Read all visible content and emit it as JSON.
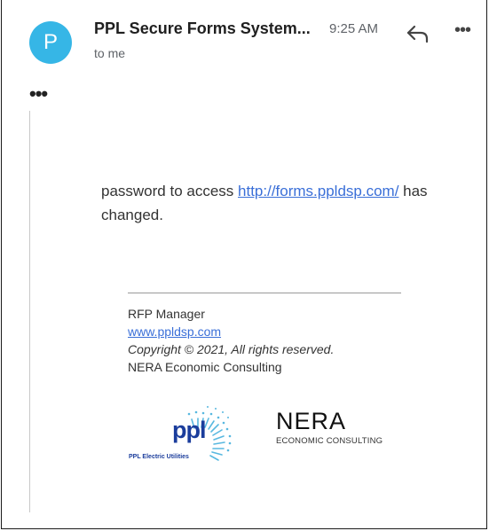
{
  "header": {
    "avatar_letter": "P",
    "avatar_color": "#36b6e6",
    "sender": "PPL Secure Forms System...",
    "time": "9:25 AM",
    "recipient": "to me",
    "reply_icon": "reply-icon",
    "more_icon": "more-options-icon",
    "more_label": "•••"
  },
  "message": {
    "expand_label": "•••",
    "text_before": "password to access ",
    "link": "http://forms.ppldsp.com/",
    "text_after": " has changed."
  },
  "signature": {
    "name": "RFP Manager",
    "website": "www.ppldsp.com",
    "copyright": "Copyright © 2021, All rights reserved.",
    "company": "NERA Economic Consulting"
  },
  "logos": {
    "ppl_text": "ppl",
    "ppl_sub": "PPL Electric Utilities",
    "nera_text": "NERA",
    "nera_sub": "ECONOMIC CONSULTING",
    "ppl_color": "#1b3d9c",
    "ppl_rays_color": "#58b8e0"
  }
}
